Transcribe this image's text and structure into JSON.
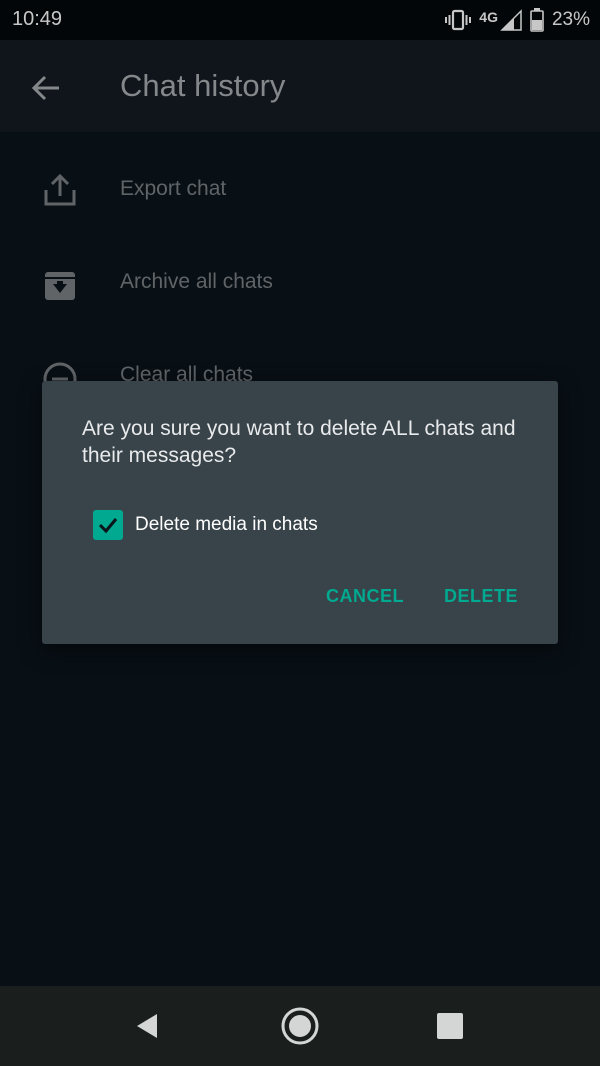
{
  "status_bar": {
    "time": "10:49",
    "network": "4G",
    "battery_percent": "23%",
    "icons": [
      "vibrate-icon",
      "signal-icon",
      "battery-icon"
    ]
  },
  "app_bar": {
    "title": "Chat history",
    "back_icon": "back-arrow-icon"
  },
  "settings": {
    "items": [
      {
        "label": "Export chat",
        "icon": "export-icon"
      },
      {
        "label": "Archive all chats",
        "icon": "archive-icon"
      },
      {
        "label": "Clear all chats",
        "icon": "clear-icon"
      }
    ]
  },
  "dialog": {
    "message": "Are you sure you want to delete ALL chats and their messages?",
    "checkbox_label": "Delete media in chats",
    "checkbox_checked": true,
    "cancel_label": "CANCEL",
    "delete_label": "DELETE"
  },
  "nav_bar": {
    "icons": [
      "nav-back-icon",
      "nav-home-icon",
      "nav-recents-icon"
    ]
  },
  "colors": {
    "accent": "#00a98f",
    "dialog_bg": "#38434a",
    "app_bar_bg": "#141c23",
    "background": "#0b141b"
  }
}
